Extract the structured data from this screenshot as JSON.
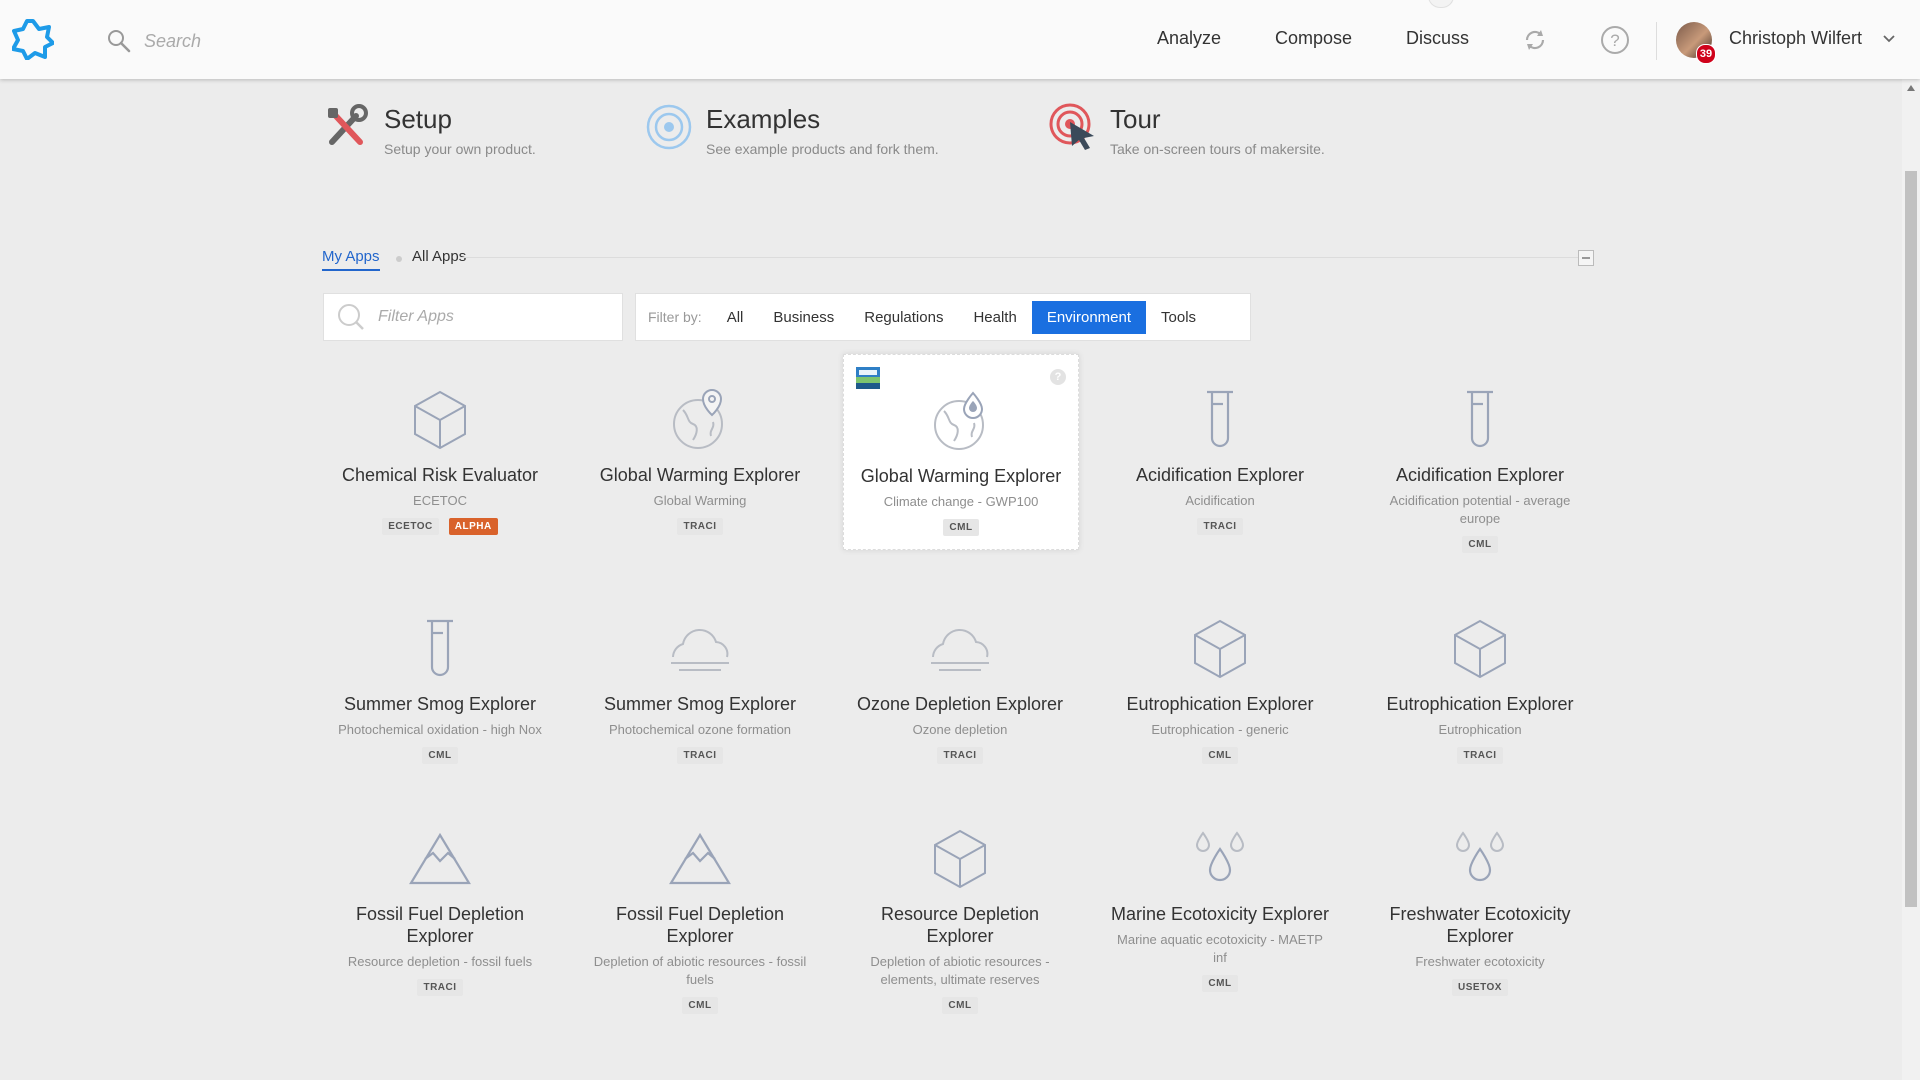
{
  "header": {
    "search_placeholder": "Search",
    "nav": [
      "Analyze",
      "Compose",
      "Discuss"
    ],
    "user": {
      "name": "Christoph Wilfert",
      "notifications": "39"
    }
  },
  "quick_links": [
    {
      "title": "Setup",
      "subtitle": "Setup your own product."
    },
    {
      "title": "Examples",
      "subtitle": "See example products and fork them."
    },
    {
      "title": "Tour",
      "subtitle": "Take on-screen tours of makersite."
    }
  ],
  "tabs": {
    "my_apps": "My Apps",
    "all_apps": "All Apps"
  },
  "filter": {
    "placeholder": "Filter Apps",
    "label": "Filter by:",
    "options": [
      "All",
      "Business",
      "Regulations",
      "Health",
      "Environment",
      "Tools"
    ],
    "active": "Environment"
  },
  "apps": [
    {
      "title": "Chemical Risk Evaluator",
      "subtitle": "ECETOC",
      "badges": [
        "ECETOC",
        "ALPHA"
      ],
      "icon": "cube-icon"
    },
    {
      "title": "Global Warming Explorer",
      "subtitle": "Global Warming",
      "badges": [
        "TRACI"
      ],
      "icon": "globe-pin-icon"
    },
    {
      "title": "Global Warming Explorer",
      "subtitle": "Climate change - GWP100",
      "badges": [
        "CML"
      ],
      "icon": "globe-drop-icon"
    },
    {
      "title": "Acidification Explorer",
      "subtitle": "Acidification",
      "badges": [
        "TRACI"
      ],
      "icon": "test-tube-icon"
    },
    {
      "title": "Acidification Explorer",
      "subtitle": "Acidification potential - average europe",
      "badges": [
        "CML"
      ],
      "icon": "test-tube-icon"
    },
    {
      "title": "Summer Smog Explorer",
      "subtitle": "Photochemical oxidation - high Nox",
      "badges": [
        "CML"
      ],
      "icon": "test-tube-icon"
    },
    {
      "title": "Summer Smog Explorer",
      "subtitle": "Photochemical ozone formation",
      "badges": [
        "TRACI"
      ],
      "icon": "cloud-icon"
    },
    {
      "title": "Ozone Depletion Explorer",
      "subtitle": "Ozone depletion",
      "badges": [
        "TRACI"
      ],
      "icon": "cloud-icon"
    },
    {
      "title": "Eutrophication Explorer",
      "subtitle": "Eutrophication - generic",
      "badges": [
        "CML"
      ],
      "icon": "cube-icon"
    },
    {
      "title": "Eutrophication Explorer",
      "subtitle": "Eutrophication",
      "badges": [
        "TRACI"
      ],
      "icon": "cube-icon"
    },
    {
      "title": "Fossil Fuel Depletion Explorer",
      "subtitle": "Resource depletion - fossil fuels",
      "badges": [
        "TRACI"
      ],
      "icon": "mountain-icon"
    },
    {
      "title": "Fossil Fuel Depletion Explorer",
      "subtitle": "Depletion of abiotic resources - fossil fuels",
      "badges": [
        "CML"
      ],
      "icon": "mountain-icon"
    },
    {
      "title": "Resource Depletion Explorer",
      "subtitle": "Depletion of abiotic resources - elements, ultimate reserves",
      "badges": [
        "CML"
      ],
      "icon": "cube-icon"
    },
    {
      "title": "Marine Ecotoxicity Explorer",
      "subtitle": "Marine aquatic ecotoxicity - MAETP inf",
      "badges": [
        "CML"
      ],
      "icon": "drops-icon"
    },
    {
      "title": "Freshwater Ecotoxicity Explorer",
      "subtitle": "Freshwater ecotoxicity",
      "badges": [
        "USETOX"
      ],
      "icon": "drops-icon"
    }
  ],
  "colors": {
    "accent": "#1a6fe0",
    "logo": "#1e9be8",
    "alpha_badge": "#d9622b",
    "icon_stroke": "#9aa4b8",
    "notification": "#d0021b"
  }
}
